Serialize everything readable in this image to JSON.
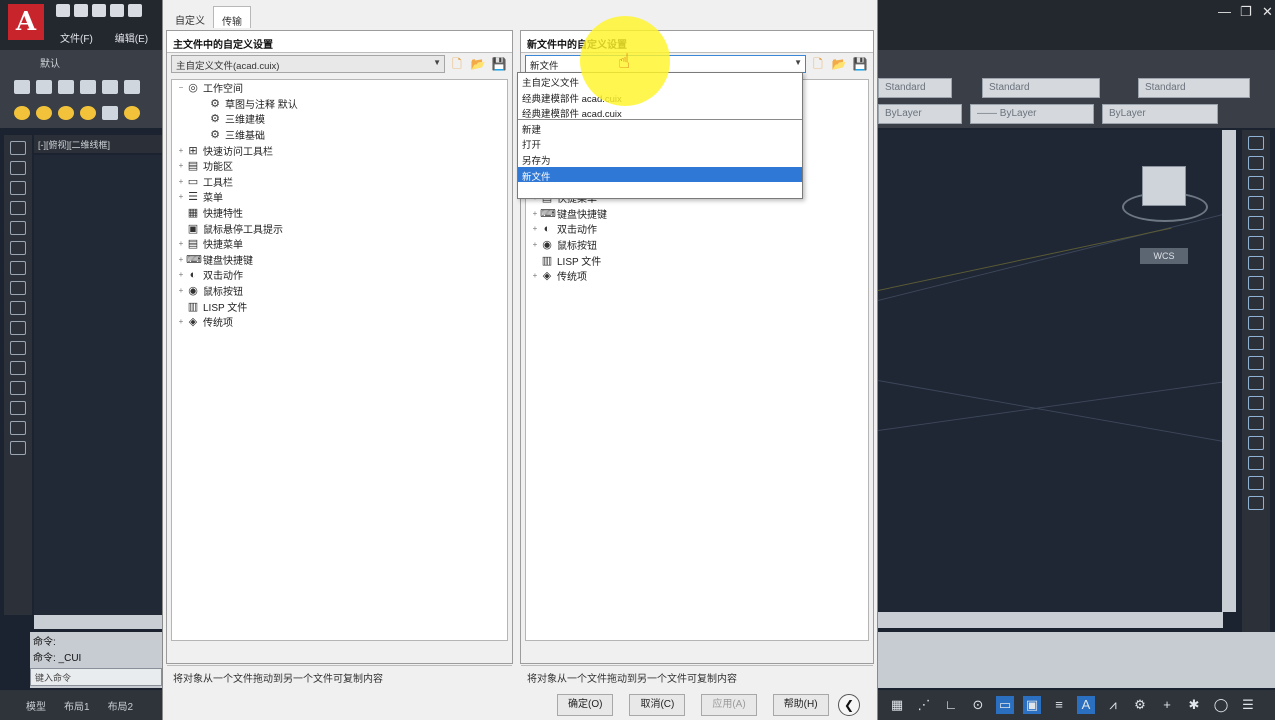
{
  "app": {
    "logo": "A",
    "menu": [
      "文件(F)",
      "编辑(E)"
    ],
    "ribbon_tab": "默认",
    "file_tab": "[-][俯视][二维线框]",
    "right_combos": [
      "Standard",
      "Standard",
      "ByLayer",
      "—— ByLayer",
      "ByLayer"
    ],
    "wcs_label": "WCS",
    "command_history": [
      "命令:",
      "命令: _CUI"
    ],
    "command_placeholder": "键入命令",
    "layout_tabs": [
      "模型",
      "布局1",
      "布局2"
    ],
    "colors": {
      "cad_bg": "#1f2634",
      "accent_red": "#c8242b",
      "selection_blue": "#2f78d6"
    }
  },
  "dialog": {
    "tabs": [
      "自定义",
      "传输"
    ],
    "active_tab": "传输",
    "left": {
      "title": "主文件中的自定义设置",
      "file_combo": "主自定义文件(acad.cuix)",
      "tree": [
        {
          "label": "工作空间",
          "icon": "workspace-icon",
          "level": 0,
          "exp": "−"
        },
        {
          "label": "草图与注释 默认",
          "icon": "gear-icon",
          "level": 1,
          "exp": ""
        },
        {
          "label": "三维建模",
          "icon": "gear-icon",
          "level": 1,
          "exp": ""
        },
        {
          "label": "三维基础",
          "icon": "gear-icon",
          "level": 1,
          "exp": ""
        },
        {
          "label": "快速访问工具栏",
          "icon": "quick-access-icon",
          "level": 0,
          "exp": "+"
        },
        {
          "label": "功能区",
          "icon": "ribbon-icon",
          "level": 0,
          "exp": "+"
        },
        {
          "label": "工具栏",
          "icon": "toolbar-icon",
          "level": 0,
          "exp": "+"
        },
        {
          "label": "菜单",
          "icon": "menu-icon",
          "level": 0,
          "exp": "+"
        },
        {
          "label": "快捷特性",
          "icon": "quick-properties-icon",
          "level": 0,
          "exp": ""
        },
        {
          "label": "鼠标悬停工具提示",
          "icon": "rollover-tooltip-icon",
          "level": 0,
          "exp": ""
        },
        {
          "label": "快捷菜单",
          "icon": "shortcut-menu-icon",
          "level": 0,
          "exp": "+"
        },
        {
          "label": "键盘快捷键",
          "icon": "keyboard-shortcut-icon",
          "level": 0,
          "exp": "+"
        },
        {
          "label": "双击动作",
          "icon": "double-click-icon",
          "level": 0,
          "exp": "+"
        },
        {
          "label": "鼠标按钮",
          "icon": "mouse-button-icon",
          "level": 0,
          "exp": "+"
        },
        {
          "label": "LISP 文件",
          "icon": "lisp-file-icon",
          "level": 0,
          "exp": ""
        },
        {
          "label": "传统项",
          "icon": "legacy-icon",
          "level": 0,
          "exp": "+"
        }
      ],
      "status": "将对象从一个文件拖动到另一个文件可复制内容"
    },
    "right": {
      "title": "新文件中的自定义设置",
      "file_combo": "新文件",
      "dropdown": [
        {
          "label": "主自定义文件",
          "sep": false,
          "sel": false
        },
        {
          "label": "经典建模部件 acad.cuix",
          "sep": false,
          "sel": false
        },
        {
          "label": "经典建模部件 acad.cuix",
          "sep": true,
          "sel": false
        },
        {
          "label": "新建",
          "sep": false,
          "sel": false
        },
        {
          "label": "打开",
          "sep": false,
          "sel": false
        },
        {
          "label": "另存为",
          "sep": false,
          "sel": false
        },
        {
          "label": "新文件",
          "sep": false,
          "sel": true
        }
      ],
      "tree": [
        {
          "label": "快捷菜单",
          "icon": "shortcut-menu-icon",
          "exp": "+"
        },
        {
          "label": "键盘快捷键",
          "icon": "keyboard-shortcut-icon",
          "exp": "+"
        },
        {
          "label": "双击动作",
          "icon": "double-click-icon",
          "exp": "+"
        },
        {
          "label": "鼠标按钮",
          "icon": "mouse-button-icon",
          "exp": "+"
        },
        {
          "label": "LISP 文件",
          "icon": "lisp-file-icon",
          "exp": ""
        },
        {
          "label": "传统项",
          "icon": "legacy-icon",
          "exp": "+"
        }
      ],
      "status": "将对象从一个文件拖动到另一个文件可复制内容"
    },
    "buttons": {
      "ok": "确定(O)",
      "cancel": "取消(C)",
      "apply": "应用(A)",
      "help": "帮助(H)"
    }
  }
}
